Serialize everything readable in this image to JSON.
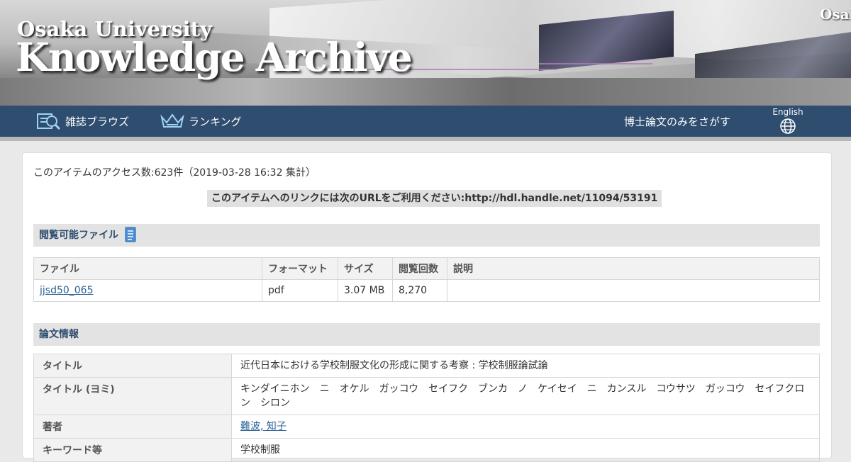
{
  "banner": {
    "title_small": "Osaka University",
    "title_big": "Knowledge Archive",
    "corner_text": "Osaka"
  },
  "nav": {
    "browse_label": "雑誌ブラウズ",
    "ranking_label": "ランキング",
    "thesis_label": "博士論文のみをさがす",
    "lang_label": "English"
  },
  "item": {
    "access_text": "このアイテムのアクセス数:623件（2019-03-28 16:32 集計）",
    "url_text": "このアイテムへのリンクには次のURLをご利用ください:http://hdl.handle.net/11094/53191"
  },
  "files_section": {
    "heading": "閲覧可能ファイル",
    "columns": [
      "ファイル",
      "フォーマット",
      "サイズ",
      "閲覧回数",
      "説明"
    ],
    "rows": [
      {
        "file": "jjsd50_065",
        "format": "pdf",
        "size": "3.07 MB",
        "views": "8,270",
        "description": ""
      }
    ]
  },
  "info_section": {
    "heading": "論文情報",
    "rows": [
      {
        "label": "タイトル",
        "value": "近代日本における学校制服文化の形成に関する考察 : 学校制服論試論"
      },
      {
        "label": "タイトル (ヨミ)",
        "value": "キンダイニホン　ニ　オケル　ガッコウ　セイフク　ブンカ　ノ　ケイセイ　ニ　カンスル　コウサツ　ガッコウ　セイフクロン　シロン"
      },
      {
        "label": "著者",
        "value": "難波, 知子"
      },
      {
        "label": "キーワード等",
        "value": "学校制服"
      }
    ]
  },
  "colors": {
    "nav_bg": "#2e4d6f",
    "link": "#2a6496",
    "section_bg": "#e3e3e3"
  }
}
